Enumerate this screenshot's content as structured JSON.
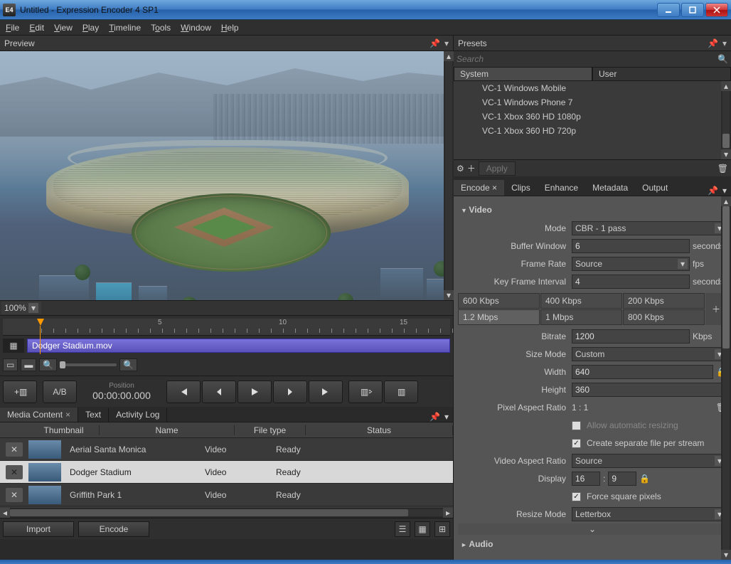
{
  "window": {
    "title": "Untitled - Expression Encoder 4 SP1",
    "app_icon": "E4"
  },
  "menu": [
    "File",
    "Edit",
    "View",
    "Play",
    "Timeline",
    "Tools",
    "Window",
    "Help"
  ],
  "preview": {
    "title": "Preview",
    "zoom": "100%"
  },
  "timeline": {
    "marks": [
      "5",
      "10",
      "15"
    ],
    "clip_name": "Dodger Stadium.mov",
    "position_label": "Position",
    "position": "00:00:00.000",
    "ab_label": "A/B"
  },
  "media": {
    "tabs": [
      "Media Content",
      "Text",
      "Activity Log"
    ],
    "columns": {
      "thumbnail": "Thumbnail",
      "name": "Name",
      "filetype": "File type",
      "status": "Status"
    },
    "rows": [
      {
        "name": "Aerial Santa Monica",
        "type": "Video",
        "status": "Ready",
        "selected": false
      },
      {
        "name": "Dodger Stadium",
        "type": "Video",
        "status": "Ready",
        "selected": true
      },
      {
        "name": "Griffith Park 1",
        "type": "Video",
        "status": "Ready",
        "selected": false
      }
    ],
    "import": "Import",
    "encode": "Encode"
  },
  "presets": {
    "title": "Presets",
    "search_placeholder": "Search",
    "tabs": {
      "system": "System",
      "user": "User"
    },
    "items": [
      "VC-1 Windows Mobile",
      "VC-1 Windows Phone 7",
      "VC-1 Xbox 360 HD 1080p",
      "VC-1 Xbox 360 HD 720p"
    ],
    "apply": "Apply"
  },
  "settings": {
    "tabs": [
      "Encode",
      "Clips",
      "Enhance",
      "Metadata",
      "Output"
    ],
    "video": {
      "header": "Video",
      "mode_label": "Mode",
      "mode": "CBR - 1 pass",
      "buffer_label": "Buffer Window",
      "buffer": "6",
      "buffer_unit": "seconds",
      "framerate_label": "Frame Rate",
      "framerate": "Source",
      "framerate_unit": "fps",
      "keyframe_label": "Key Frame Interval",
      "keyframe": "4",
      "keyframe_unit": "seconds",
      "bitrates_top": [
        "600 Kbps",
        "400 Kbps",
        "200 Kbps"
      ],
      "bitrates_bottom": [
        "1.2 Mbps",
        "1 Mbps",
        "800 Kbps"
      ],
      "bitrate_label": "Bitrate",
      "bitrate": "1200",
      "bitrate_unit": "Kbps",
      "sizemode_label": "Size Mode",
      "sizemode": "Custom",
      "width_label": "Width",
      "width": "640",
      "height_label": "Height",
      "height": "360",
      "par_label": "Pixel Aspect Ratio",
      "par": "1 : 1",
      "allow_resize": "Allow automatic resizing",
      "create_separate": "Create separate file per stream",
      "var_label": "Video Aspect Ratio",
      "var": "Source",
      "display_label": "Display",
      "display_w": "16",
      "display_h": "9",
      "force_square": "Force square pixels",
      "resizemode_label": "Resize Mode",
      "resizemode": "Letterbox"
    },
    "audio": {
      "header": "Audio"
    }
  }
}
